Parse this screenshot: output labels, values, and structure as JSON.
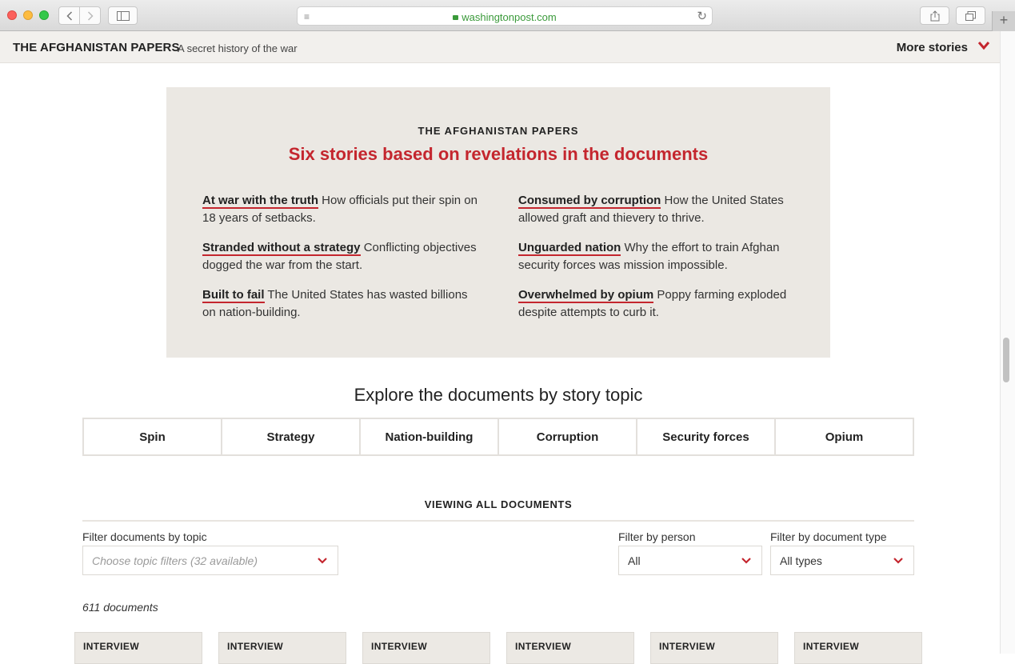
{
  "browser": {
    "url": "washingtonpost.com",
    "new_tab_glyph": "+"
  },
  "header": {
    "title": "THE AFGHANISTAN PAPERS",
    "subtitle": "A secret history of the war",
    "more_stories": "More stories",
    "accent_color": "#c4262e"
  },
  "stories_box": {
    "kicker": "THE AFGHANISTAN PAPERS",
    "headline": "Six stories based on revelations in the documents",
    "items": [
      {
        "title": "At war with the truth",
        "desc": " How officials put their spin on 18 years of setbacks."
      },
      {
        "title": "Consumed by corruption",
        "desc": " How the United States allowed graft and thievery to thrive."
      },
      {
        "title": "Stranded without a strategy",
        "desc": " Conflicting objectives dogged the war from the start."
      },
      {
        "title": "Unguarded nation",
        "desc": " Why the effort to train Afghan security forces was mission impossible."
      },
      {
        "title": "Built to fail",
        "desc": " The United States has wasted billions on nation-building."
      },
      {
        "title": "Overwhelmed by opium",
        "desc": " Poppy farming exploded despite attempts to curb it."
      }
    ]
  },
  "explore": {
    "title": "Explore the documents by story topic",
    "tabs": [
      "Spin",
      "Strategy",
      "Nation-building",
      "Corruption",
      "Security forces",
      "Opium"
    ]
  },
  "documents": {
    "viewing_label": "VIEWING ALL DOCUMENTS",
    "filter_topic": {
      "label": "Filter documents by topic",
      "placeholder": "Choose topic filters (32 available)"
    },
    "filter_person": {
      "label": "Filter by person",
      "value": "All"
    },
    "filter_type": {
      "label": "Filter by document type",
      "value": "All types"
    },
    "count": "611 documents",
    "cards": [
      "INTERVIEW",
      "INTERVIEW",
      "INTERVIEW",
      "INTERVIEW",
      "INTERVIEW",
      "INTERVIEW"
    ]
  }
}
